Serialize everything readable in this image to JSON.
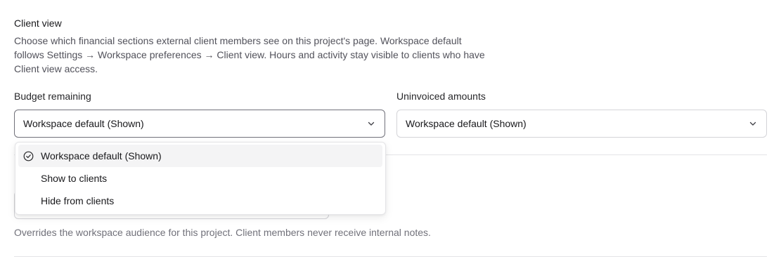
{
  "client_view": {
    "title": "Client view",
    "description": "Choose which financial sections external client members see on this project's page. Workspace default follows Settings → Workspace preferences → Client view. Hours and activity stay visible to clients who have Client view access."
  },
  "budget_remaining": {
    "label": "Budget remaining",
    "value": "Workspace default (Shown)"
  },
  "uninvoiced_amounts": {
    "label": "Uninvoiced amounts",
    "value": "Workspace default (Shown)"
  },
  "dropdown": {
    "options": [
      {
        "label": "Workspace default (Shown)",
        "selected": true
      },
      {
        "label": "Show to clients",
        "selected": false
      },
      {
        "label": "Hide from clients",
        "selected": false
      }
    ]
  },
  "audience": {
    "helper": "Overrides the workspace audience for this project. Client members never receive internal notes."
  },
  "icons": {
    "select_chevron": "chevron-down-icon",
    "selected_option": "check-circle-icon"
  },
  "colors": {
    "border": "#d4d4d8",
    "selected_bg": "#f4f4f5",
    "muted_text": "#71717a"
  }
}
